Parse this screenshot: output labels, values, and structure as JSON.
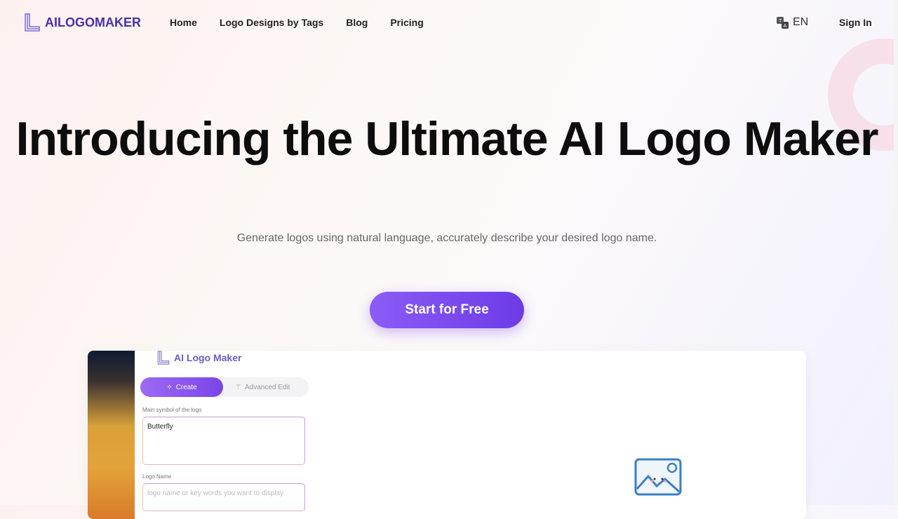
{
  "nav": {
    "brand": "AILOGOMAKER",
    "links": [
      "Home",
      "Logo Designs by Tags",
      "Blog",
      "Pricing"
    ],
    "language": "EN",
    "sign_in": "Sign In"
  },
  "hero": {
    "title": "Introducing the Ultimate AI Logo Maker",
    "subtitle": "Generate logos using natural language, accurately describe your desired logo name.",
    "cta": "Start for Free"
  },
  "preview": {
    "app_title": "AI Logo Maker",
    "tab_create": "Create",
    "tab_advanced": "Advanced Edit",
    "symbol_label": "Main symbol of the logo",
    "symbol_value": "Butterfly",
    "name_label": "Logo Name",
    "name_placeholder": "logo name or key words you want to display"
  },
  "colors": {
    "brand": "#4a2fa8",
    "accent": "#7c4dea"
  }
}
